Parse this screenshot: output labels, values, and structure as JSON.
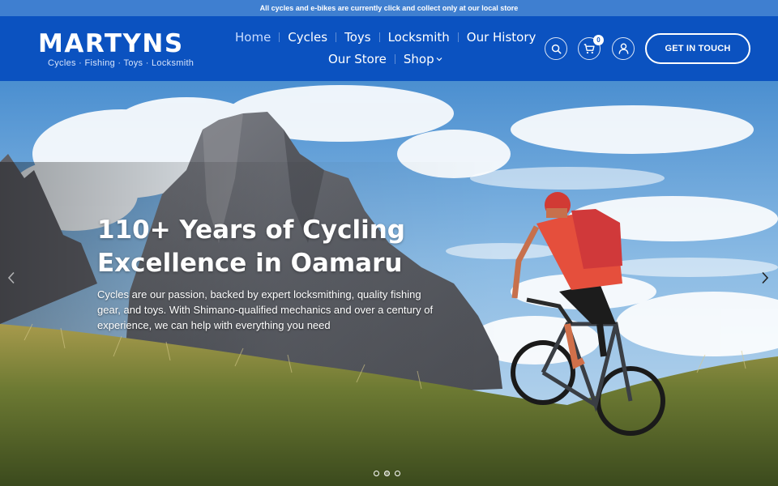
{
  "announcement": "All cycles and e-bikes are currently click and collect only at our local store",
  "brand": {
    "name": "MARTYNS",
    "tagline": "Cycles · Fishing · Toys · Locksmith"
  },
  "nav": {
    "row1": [
      {
        "label": "Home",
        "active": true
      },
      {
        "label": "Cycles"
      },
      {
        "label": "Toys"
      },
      {
        "label": "Locksmith"
      },
      {
        "label": "Our History"
      }
    ],
    "row2": [
      {
        "label": "Our Store"
      },
      {
        "label": "Shop",
        "dropdown": true
      }
    ]
  },
  "header_actions": {
    "search_icon": "search-icon",
    "cart_icon": "cart-icon",
    "cart_count": "0",
    "account_icon": "user-icon",
    "cta_label": "GET IN TOUCH"
  },
  "hero": {
    "title_line1": "110+ Years of Cycling",
    "title_line2": "Excellence in Oamaru",
    "subtitle": "Cycles are our passion, backed by expert locksmithing, quality fishing gear, and toys. With Shimano-qualified mechanics and over a century of experience, we can help with everything you need",
    "prev_icon": "chevron-left-icon",
    "next_icon": "chevron-right-icon",
    "slide_count": 3,
    "active_slide": 2
  },
  "colors": {
    "announcement_bg": "#3f7fd0",
    "header_bg": "#0b52c0",
    "text_on_brand": "#ffffff"
  }
}
